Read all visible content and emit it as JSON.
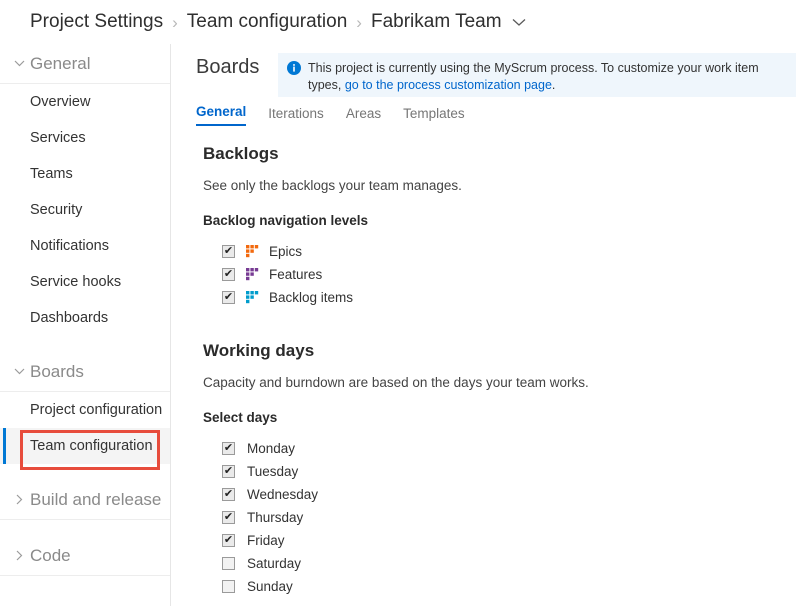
{
  "breadcrumb": {
    "items": [
      {
        "label": "Project Settings"
      },
      {
        "label": "Team configuration"
      },
      {
        "label": "Fabrikam Team"
      }
    ],
    "separator": "›",
    "dropdown_icon": "chevron-down-icon"
  },
  "sidebar": {
    "sections": [
      {
        "label": "General",
        "expanded": true,
        "chevron": "chevron-down-icon",
        "items": [
          {
            "label": "Overview",
            "selected": false
          },
          {
            "label": "Services",
            "selected": false
          },
          {
            "label": "Teams",
            "selected": false
          },
          {
            "label": "Security",
            "selected": false
          },
          {
            "label": "Notifications",
            "selected": false
          },
          {
            "label": "Service hooks",
            "selected": false
          },
          {
            "label": "Dashboards",
            "selected": false
          }
        ]
      },
      {
        "label": "Boards",
        "expanded": true,
        "chevron": "chevron-down-icon",
        "items": [
          {
            "label": "Project configuration",
            "selected": false
          },
          {
            "label": "Team configuration",
            "selected": true
          }
        ]
      },
      {
        "label": "Build and release",
        "expanded": false,
        "chevron": "chevron-right-icon",
        "items": []
      },
      {
        "label": "Code",
        "expanded": false,
        "chevron": "chevron-right-icon",
        "items": []
      }
    ]
  },
  "main": {
    "page_title": "Boards",
    "banner": {
      "icon": "info-icon",
      "text_before_link": "This project is currently using the MyScrum process. To customize your work item types, ",
      "link_text": "go to the process customization page",
      "text_after_link": ".",
      "background": "#eff6fc",
      "icon_color": "#0078d4",
      "link_color": "#0066cc"
    },
    "tabs": [
      {
        "label": "General",
        "active": true
      },
      {
        "label": "Iterations",
        "active": false
      },
      {
        "label": "Areas",
        "active": false
      },
      {
        "label": "Templates",
        "active": false
      }
    ],
    "backlogs": {
      "title": "Backlogs",
      "description": "See only the backlogs your team manages.",
      "sub_label": "Backlog navigation levels",
      "levels": [
        {
          "label": "Epics",
          "checked": true,
          "icon": "backlog-level-icon",
          "color": "#f2690d"
        },
        {
          "label": "Features",
          "checked": true,
          "icon": "backlog-level-icon",
          "color": "#773b93"
        },
        {
          "label": "Backlog items",
          "checked": true,
          "icon": "backlog-level-icon",
          "color": "#009ccc"
        }
      ]
    },
    "working_days": {
      "title": "Working days",
      "description": "Capacity and burndown are based on the days your team works.",
      "sub_label": "Select days",
      "days": [
        {
          "label": "Monday",
          "checked": true
        },
        {
          "label": "Tuesday",
          "checked": true
        },
        {
          "label": "Wednesday",
          "checked": true
        },
        {
          "label": "Thursday",
          "checked": true
        },
        {
          "label": "Friday",
          "checked": true
        },
        {
          "label": "Saturday",
          "checked": false
        },
        {
          "label": "Sunday",
          "checked": false
        }
      ]
    }
  },
  "annotation": {
    "type": "highlight-rectangle",
    "color": "#e74c3c",
    "target": "Team configuration"
  },
  "colors": {
    "accent": "#0078d4",
    "link": "#0066cc",
    "annotation": "#e74c3c",
    "selected_bg": "#f4f4f4"
  }
}
